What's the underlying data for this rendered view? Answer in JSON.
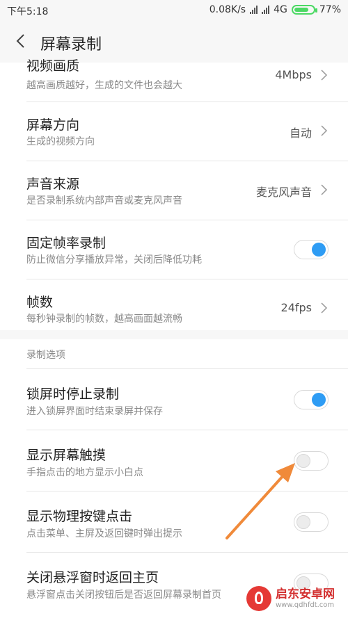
{
  "status_bar": {
    "time": "下午5:18",
    "speed": "0.08K/s",
    "network": "4G",
    "battery_percent": "77%",
    "battery_level": 0.77
  },
  "header": {
    "title": "屏幕录制"
  },
  "settings": [
    {
      "label": "视频画质",
      "desc": "越高画质越好，生成的文件也会越大",
      "value": "4Mbps",
      "type": "select"
    },
    {
      "label": "屏幕方向",
      "desc": "生成的视频方向",
      "value": "自动",
      "type": "select"
    },
    {
      "label": "声音来源",
      "desc": "是否录制系统内部声音或麦克风声音",
      "value": "麦克风声音",
      "type": "select"
    },
    {
      "label": "固定帧率录制",
      "desc": "防止微信分享播放异常，关闭后降低功耗",
      "type": "toggle",
      "on": true
    },
    {
      "label": "帧数",
      "desc": "每秒钟录制的帧数，越高画面越流畅",
      "value": "24fps",
      "type": "select"
    }
  ],
  "record_options": {
    "header": "录制选项",
    "items": [
      {
        "label": "锁屏时停止录制",
        "desc": "进入锁屏界面时结束录屏并保存",
        "type": "toggle",
        "on": true
      },
      {
        "label": "显示屏幕触摸",
        "desc": "手指点击的地方显示小白点",
        "type": "toggle",
        "on": false
      },
      {
        "label": "显示物理按键点击",
        "desc": "点击菜单、主屏及返回键时弹出提示",
        "type": "toggle",
        "on": false
      },
      {
        "label": "关闭悬浮窗时返回主页",
        "desc": "悬浮窗点击关闭按钮后是否返回屏幕录制首页",
        "type": "toggle",
        "on": false
      }
    ]
  },
  "watermark": {
    "main": "启东安卓网",
    "sub": "www.qdhfdt.com"
  },
  "colors": {
    "toggle_on": "#2e9cf4",
    "annotation_arrow": "#f08a3a",
    "battery": "#4cd964"
  }
}
